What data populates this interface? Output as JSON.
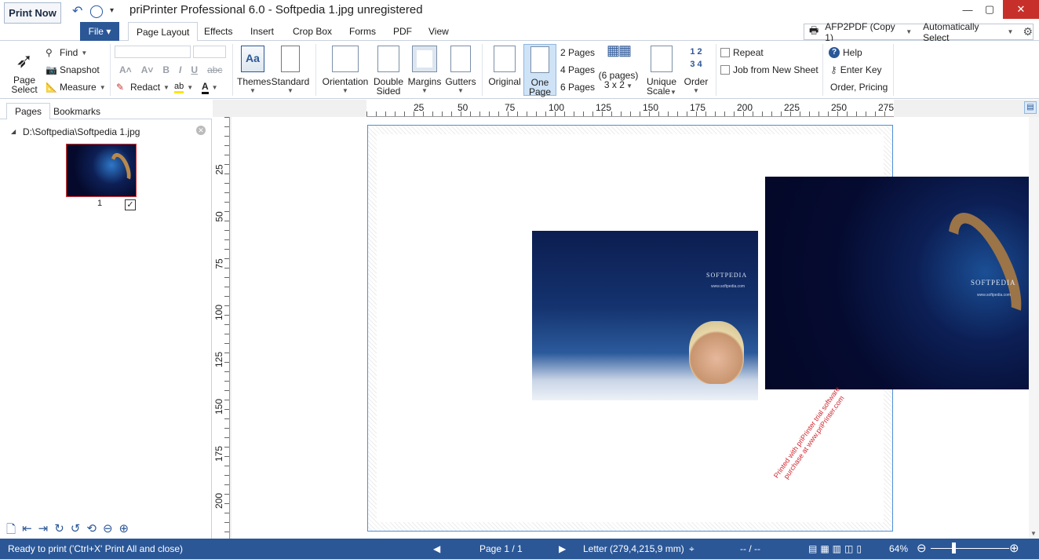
{
  "titlebar": {
    "print_now": "Print Now",
    "title": "priPrinter Professional 6.0 - Softpedia 1.jpg unregistered"
  },
  "tabs": {
    "file": "File",
    "items": [
      "Page Layout",
      "Effects",
      "Insert",
      "Crop Box",
      "Forms",
      "PDF",
      "View"
    ]
  },
  "printer": {
    "name": "AFP2PDF (Copy 1)",
    "select": "Automatically Select"
  },
  "ribbon": {
    "page_select": "Page\nSelect",
    "find": "Find",
    "snapshot": "Snapshot",
    "measure": "Measure",
    "redact": "Redact",
    "themes": "Themes",
    "standard": "Standard",
    "orientation": "Orientation",
    "double_sided_1": "Double",
    "double_sided_2": "Sided",
    "margins": "Margins",
    "gutters": "Gutters",
    "original": "Original",
    "one_page_1": "One",
    "one_page_2": "Page",
    "two_pages": "2 Pages",
    "four_pages": "4 Pages",
    "six_pages": "6 Pages",
    "six_pages_grid_1": "(6 pages)",
    "six_pages_grid_2": "3 x 2",
    "unique_scale_1": "Unique",
    "unique_scale_2": "Scale",
    "order": "Order",
    "repeat": "Repeat",
    "job_new_sheet": "Job from New Sheet",
    "help": "Help",
    "enter_key": "Enter Key",
    "order_pricing": "Order, Pricing"
  },
  "left_panel": {
    "tab_pages": "Pages",
    "tab_bookmarks": "Bookmarks",
    "file_path": "D:\\Softpedia\\Softpedia 1.jpg",
    "page_number": "1"
  },
  "rulers": {
    "h_ticks": [
      "25",
      "50",
      "75",
      "100",
      "125",
      "150",
      "175",
      "200",
      "225",
      "250",
      "275"
    ],
    "v_ticks": [
      "25",
      "50",
      "75",
      "100",
      "125",
      "150",
      "175",
      "200"
    ]
  },
  "page": {
    "image_logo": "SOFTPEDIA",
    "image_url": "www.softpedia.com",
    "watermark_1": "Printed with priPrinter trial software",
    "watermark_2": "purchase at www.priPrinter.com"
  },
  "status": {
    "message": "Ready to print ('Ctrl+X' Print All and close)",
    "page": "Page 1 / 1",
    "paper": "Letter (279,4,215,9 mm)",
    "coords": "-- / --",
    "zoom": "64%"
  },
  "colors": {
    "accent": "#2b5797",
    "page_border": "#4f8ed6",
    "watermark": "#d0262e"
  }
}
